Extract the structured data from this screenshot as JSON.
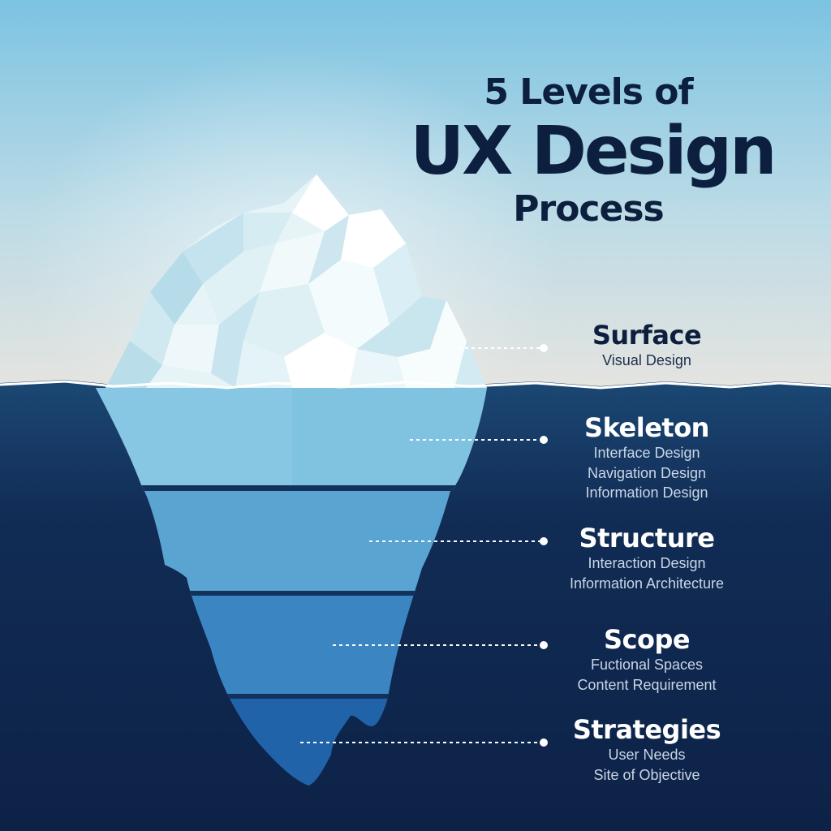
{
  "title": {
    "line1": "5 Levels of",
    "line2": "UX Design",
    "line3": "Process"
  },
  "levels": [
    {
      "name": "Surface",
      "items": [
        "Visual Design"
      ]
    },
    {
      "name": "Skeleton",
      "items": [
        "Interface Design",
        "Navigation Design",
        "Information Design"
      ]
    },
    {
      "name": "Structure",
      "items": [
        "Interaction Design",
        "Information Architecture"
      ]
    },
    {
      "name": "Scope",
      "items": [
        "Fuctional Spaces",
        "Content Requirement"
      ]
    },
    {
      "name": "Strategies",
      "items": [
        "User Needs",
        "Site of Objective"
      ]
    }
  ],
  "colors": {
    "sky_top": "#7cc3e2",
    "sky_bottom": "#e5e4e0",
    "deep_sea": "#0e2548",
    "title_text": "#0d1f3e",
    "iceberg_light": "#f4fbfd",
    "iceberg_under_top": "#84c7e3",
    "iceberg_under_bottom": "#1d5ea3"
  }
}
